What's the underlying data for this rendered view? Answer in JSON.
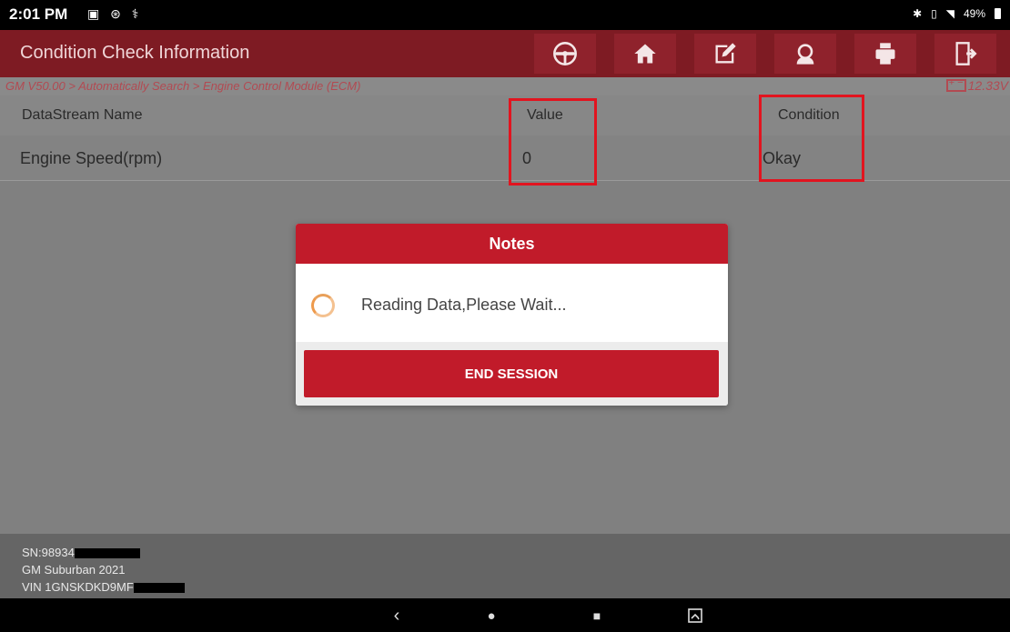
{
  "status_bar": {
    "time": "2:01 PM",
    "left_icons": "▣ ⊛ ⚕",
    "battery": "49%"
  },
  "title_bar": {
    "title": "Condition Check Information",
    "buttons": [
      "steering-wheel-icon",
      "home-icon",
      "edit-icon",
      "support-icon",
      "print-icon",
      "exit-icon"
    ]
  },
  "breadcrumb": {
    "path": "GM V50.00 > Automatically Search > Engine Control Module (ECM)",
    "voltage": "12.33V"
  },
  "table": {
    "headers": {
      "name": "DataStream Name",
      "value": "Value",
      "condition": "Condition"
    },
    "rows": [
      {
        "name": "Engine Speed(rpm)",
        "value": "0",
        "condition": "Okay"
      }
    ]
  },
  "dialog": {
    "title": "Notes",
    "message": "Reading Data,Please Wait...",
    "button": "END SESSION"
  },
  "footer": {
    "sn": "SN:98934",
    "vehicle": "GM Suburban 2021",
    "vin": "VIN 1GNSKDKD9MF"
  },
  "nav": {
    "back": "‹",
    "home": "●",
    "recents": "■"
  },
  "colors": {
    "title_bar": "#7e1b23",
    "dialog_accent": "#c11b2a",
    "highlight": "#e2141f"
  }
}
